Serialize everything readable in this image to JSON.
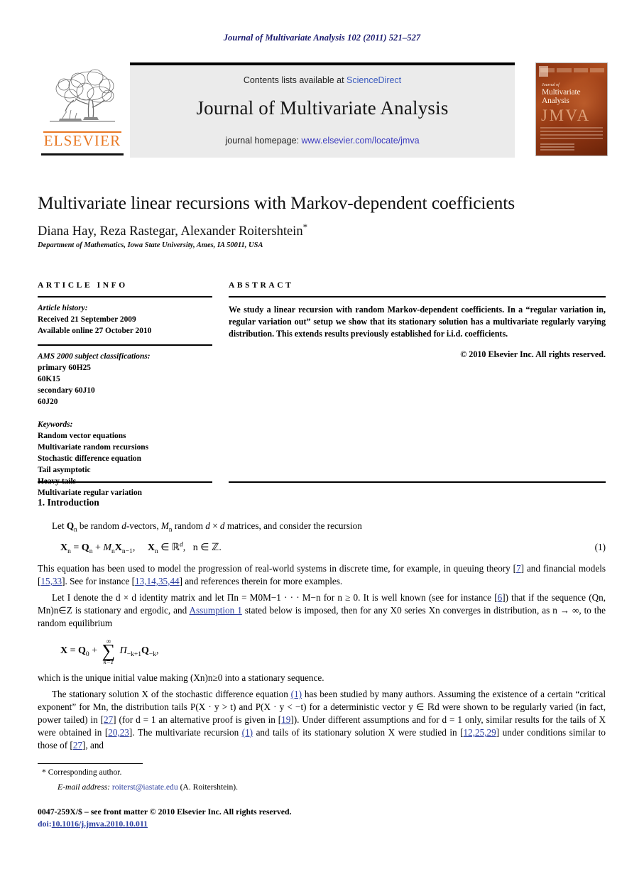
{
  "running_head": "Journal of Multivariate Analysis 102 (2011) 521–527",
  "masthead": {
    "contents_prefix": "Contents lists available at ",
    "sciencedirect": "ScienceDirect",
    "journal_name": "Journal of Multivariate Analysis",
    "homepage_prefix": "journal homepage: ",
    "homepage_url": "www.elsevier.com/locate/jmva",
    "publisher_logo_text": "ELSEVIER",
    "cover": {
      "small_title": "Journal of",
      "big_title_line1": "Multivariate",
      "big_title_line2": "Analysis",
      "acronym": "JMVA"
    }
  },
  "article": {
    "title": "Multivariate linear recursions with Markov-dependent coefficients",
    "authors": "Diana Hay, Reza Rastegar, Alexander Roitershtein",
    "author_marker": "*",
    "affiliation": "Department of Mathematics, Iowa State University, Ames, IA 50011, USA"
  },
  "info": {
    "label": "ARTICLE INFO",
    "history_header": "Article history:",
    "history": [
      "Received 21 September 2009",
      "Available online 27 October 2010"
    ],
    "ams_header": "AMS 2000 subject classifications:",
    "ams": [
      "primary 60H25",
      "60K15",
      "secondary 60J10",
      "60J20"
    ],
    "keywords_header": "Keywords:",
    "keywords": [
      "Random vector equations",
      "Multivariate random recursions",
      "Stochastic difference equation",
      "Tail asymptotic",
      "Heavy tails",
      "Multivariate regular variation"
    ]
  },
  "abstract": {
    "label": "ABSTRACT",
    "text": "We study a linear recursion with random Markov-dependent coefficients. In a “regular variation in, regular variation out” setup we show that its stationary solution has a multivariate regularly varying distribution. This extends results previously established for i.i.d. coefficients.",
    "copyright": "© 2010 Elsevier Inc. All rights reserved."
  },
  "body": {
    "section_number_title": "1. Introduction",
    "para1": "Let Qn be random d-vectors, Mn random d × d matrices, and consider the recursion",
    "eq1_number": "(1)",
    "para2_a": "This equation has been used to model the progression of real-world systems in discrete time, for example, in queuing theory [",
    "para2_cite1": "7",
    "para2_b": "] and financial models [",
    "para2_cite2": "15,33",
    "para2_c": "]. See for instance [",
    "para2_cite3": "13,14,35,44",
    "para2_d": "] and references therein for more examples.",
    "para3_a": "Let I denote the d × d identity matrix and let Πn = M0M−1 · · · M−n for n ≥ 0. It is well known (see for instance [",
    "para3_cite1": "6",
    "para3_b": "]) that if the sequence (Qn, Mn)n∈Z is stationary and ergodic, and ",
    "para3_assumption_link": "Assumption 1",
    "para3_c": " stated below is imposed, then for any X0 series Xn converges in distribution, as n → ∞, to the random equilibrium",
    "para4": "which is the unique initial value making (Xn)n≥0 into a stationary sequence.",
    "para5_a": "The stationary solution X of the stochastic difference equation ",
    "para5_eqlink1": "(1)",
    "para5_b": " has been studied by many authors. Assuming the existence of a certain “critical exponent” for Mn, the distribution tails P(X · y > t) and P(X · y < −t) for a deterministic vector y ∈ ℝd were shown to be regularly varied (in fact, power tailed) in [",
    "para5_cite1": "27",
    "para5_c": "] (for d = 1 an alternative proof is given in [",
    "para5_cite2": "19",
    "para5_d": "]). Under different assumptions and for d = 1 only, similar results for the tails of X were obtained in [",
    "para5_cite3": "20,23",
    "para5_e": "]. The multivariate recursion ",
    "para5_eqlink2": "(1)",
    "para5_f": " and tails of its stationary solution X were studied in [",
    "para5_cite4": "12,25,29",
    "para5_g": "] under conditions similar to those of [",
    "para5_cite5": "27",
    "para5_h": "], and"
  },
  "footer": {
    "corresponding_marker": "*",
    "corresponding_text": "Corresponding author.",
    "email_label": "E-mail address:",
    "email": "roiterst@iastate.edu",
    "email_owner": "(A. Roitershtein).",
    "front_matter": "0047-259X/$ – see front matter © 2010 Elsevier Inc. All rights reserved.",
    "doi_label": "doi:",
    "doi": "10.1016/j.jmva.2010.10.011"
  },
  "colors": {
    "link_blue": "#2d3f9e",
    "header_navy": "#1a1a6e",
    "elsevier_orange": "#e87722",
    "masthead_gray": "#ebebeb"
  }
}
